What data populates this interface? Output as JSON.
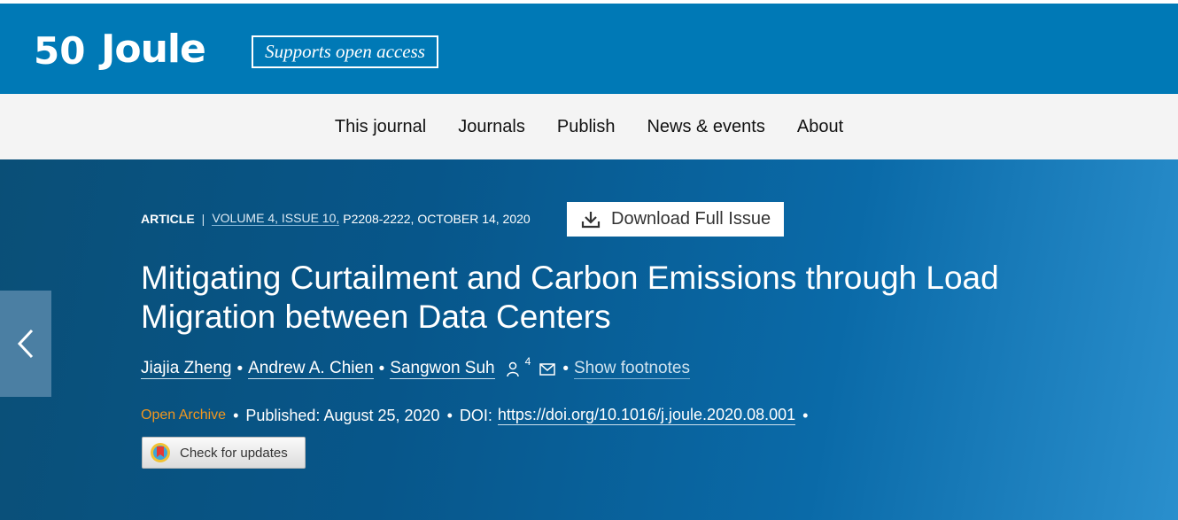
{
  "header": {
    "logo_text": "Joule",
    "logo_mark": "50",
    "open_access_badge": "Supports open access"
  },
  "nav": {
    "items": [
      "This journal",
      "Journals",
      "Publish",
      "News & events",
      "About"
    ]
  },
  "article": {
    "type": "ARTICLE",
    "separator": "|",
    "volume_link": "VOLUME 4, ISSUE 10,",
    "pages_date": "P2208-2222, OCTOBER 14, 2020",
    "download_label": "Download Full Issue",
    "title": "Mitigating Curtailment and Carbon Emissions through Load Migration between Data Centers",
    "authors": [
      "Jiajia Zheng",
      "Andrew A. Chien",
      "Sangwon Suh"
    ],
    "author_count_sup": "4",
    "show_footnotes": "Show footnotes",
    "access_label": "Open Archive",
    "published": "Published: August 25, 2020",
    "doi_label": "DOI:",
    "doi_link": "https://doi.org/10.1016/j.joule.2020.08.001",
    "check_updates": "Check for updates"
  },
  "icons": {
    "prev": "chevron-left-icon",
    "download": "download-icon",
    "person": "person-icon",
    "mail": "mail-icon",
    "crossmark": "crossmark-icon"
  },
  "colors": {
    "brand": "#0079b6",
    "open_archive": "#f0961e"
  }
}
